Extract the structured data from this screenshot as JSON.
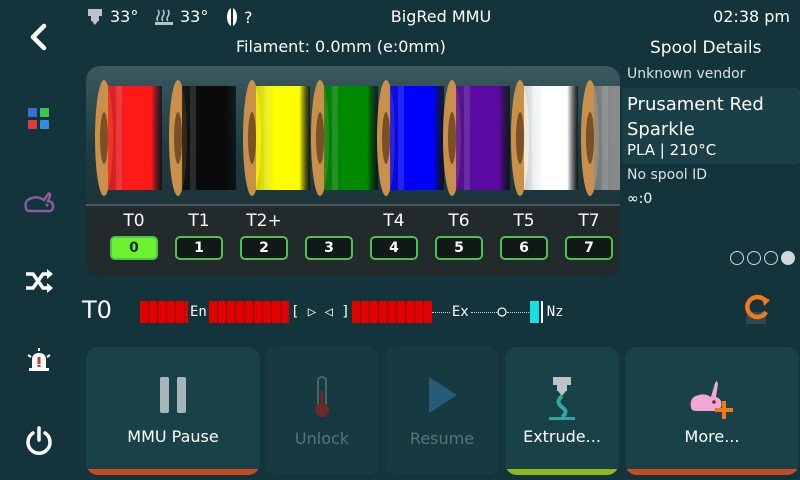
{
  "topbar": {
    "extruder_temp": "33°",
    "bed_temp": "33°",
    "filament_sensor_status": "?",
    "title": "BigRed MMU",
    "clock": "02:38 pm"
  },
  "filament_status": "Filament: 0.0mm (e:0mm)",
  "spools": [
    {
      "color": "#ff1a1a"
    },
    {
      "color": "#0a0a0a"
    },
    {
      "color": "#ffff00"
    },
    {
      "color": "#008a00"
    },
    {
      "color": "#0000ff"
    },
    {
      "color": "#5a0aa0"
    },
    {
      "color": "#ffffff"
    },
    {
      "color": "#8a8a8a"
    }
  ],
  "gates": [
    {
      "tool": "T0",
      "gate": "0",
      "active": true
    },
    {
      "tool": "T1",
      "gate": "1",
      "active": false
    },
    {
      "tool": "T2+",
      "gate": "2",
      "active": false
    },
    {
      "tool": "",
      "gate": "3",
      "active": false
    },
    {
      "tool": "T4",
      "gate": "4",
      "active": false
    },
    {
      "tool": "T6",
      "gate": "5",
      "active": false
    },
    {
      "tool": "T5",
      "gate": "6",
      "active": false
    },
    {
      "tool": "T7",
      "gate": "7",
      "active": false
    }
  ],
  "details": {
    "title": "Spool Details",
    "vendor": "Unknown vendor",
    "material_name": "Prusament Red Sparkle",
    "material_temp": "PLA | 210°C",
    "spool_id": "No spool ID",
    "weight": "∞:0",
    "page_count": 4,
    "page_current": 4
  },
  "path": {
    "tool": "T0",
    "entry_label": "En",
    "gate_bracket_left": "[ ▷ ◁ ]",
    "exit_label": "Ex",
    "nozzle_label": "Nz"
  },
  "actions": [
    {
      "label": "MMU Pause",
      "icon": "pause-icon",
      "enabled": true,
      "strip": "#c84a22"
    },
    {
      "label": "Unlock",
      "icon": "thermometer-icon",
      "enabled": false,
      "strip": ""
    },
    {
      "label": "Resume",
      "icon": "play-icon",
      "enabled": false,
      "strip": ""
    },
    {
      "label": "Extrude...",
      "icon": "extruder-icon",
      "enabled": true,
      "strip": "#8fb81a"
    },
    {
      "label": "More...",
      "icon": "rabbit-plus-icon",
      "enabled": true,
      "strip": "#c84a22"
    }
  ],
  "nav": {
    "icons": [
      "back-icon",
      "dashboard-icon",
      "mmu-rabbit-icon",
      "shuffle-icon",
      "alarm-icon",
      "power-icon"
    ]
  }
}
